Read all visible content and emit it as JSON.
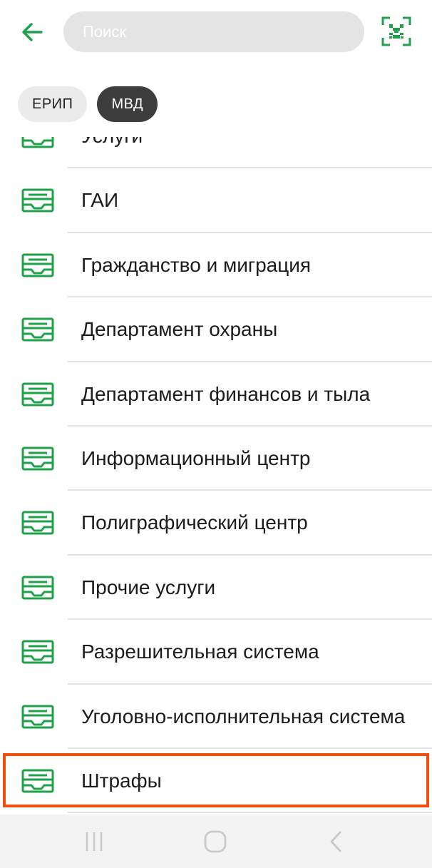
{
  "colors": {
    "accent": "#1fa14a",
    "chip_active_bg": "#3d3d3d",
    "chip_inactive_bg": "#ebebeb",
    "highlight": "#f24e0d"
  },
  "header": {
    "back_icon": "arrow-left-icon",
    "search_placeholder": "Поиск",
    "search_value": "",
    "qr_icon": "qr-scan-icon"
  },
  "chips": [
    {
      "label": "ЕРИП",
      "active": false
    },
    {
      "label": "МВД",
      "active": true
    }
  ],
  "list": {
    "item_icon": "receipt-tray-icon",
    "items": [
      {
        "label": "Услуги"
      },
      {
        "label": "ГАИ"
      },
      {
        "label": "Гражданство и миграция"
      },
      {
        "label": "Департамент охраны"
      },
      {
        "label": "Департамент финансов и тыла"
      },
      {
        "label": "Информационный центр"
      },
      {
        "label": "Полиграфический центр"
      },
      {
        "label": "Прочие услуги"
      },
      {
        "label": "Разрешительная система"
      },
      {
        "label": "Уголовно-исполнительная система"
      },
      {
        "label": "Штрафы"
      }
    ]
  },
  "navbar": {
    "recent_icon": "recent-apps-icon",
    "home_icon": "home-icon",
    "back_icon": "nav-back-icon"
  }
}
